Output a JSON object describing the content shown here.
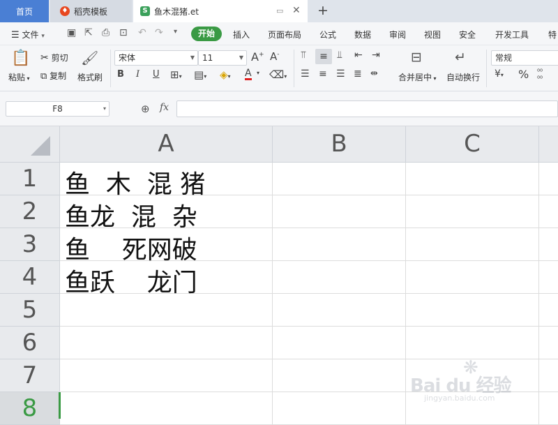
{
  "tabs": {
    "home": "首页",
    "template": "稻壳模板",
    "document": "鱼木混猪.et",
    "new_tab": "+"
  },
  "menu": {
    "file": "文件",
    "items": [
      "开始",
      "插入",
      "页面布局",
      "公式",
      "数据",
      "审阅",
      "视图",
      "安全",
      "开发工具",
      "特"
    ]
  },
  "ribbon": {
    "paste": "粘贴",
    "cut": "剪切",
    "copy": "复制",
    "format_painter": "格式刷",
    "font_name": "宋体",
    "font_size": "11",
    "merge_center": "合并居中",
    "wrap_text": "自动换行",
    "number_format": "常规",
    "percent": "%"
  },
  "formula_bar": {
    "name_box": "F8",
    "fx": "fx",
    "formula": ""
  },
  "grid": {
    "columns": [
      "A",
      "B",
      "C"
    ],
    "rows": [
      "1",
      "2",
      "3",
      "4",
      "5",
      "6",
      "7",
      "8"
    ],
    "selected_row": "8",
    "cells": [
      "鱼  木  混 猪",
      "鱼龙  混  杂",
      "鱼    死网破",
      "鱼跃    龙门"
    ]
  },
  "watermark": {
    "brand": "Bai du 经验",
    "url": "jingyan.baidu.com"
  },
  "colors": {
    "accent_green": "#3a9a44",
    "tab_blue": "#4a7fd4"
  }
}
